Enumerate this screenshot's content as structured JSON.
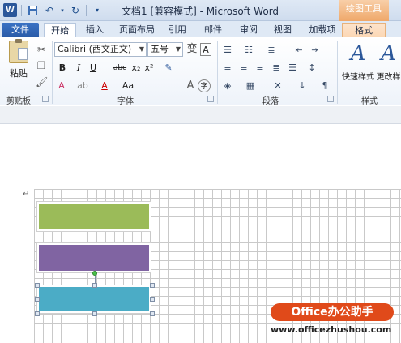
{
  "titlebar": {
    "app_icon": "W",
    "title": "文档1 [兼容模式] - Microsoft Word",
    "context_tool": "绘图工具"
  },
  "tabs": [
    {
      "label": "文件"
    },
    {
      "label": "开始"
    },
    {
      "label": "插入"
    },
    {
      "label": "页面布局"
    },
    {
      "label": "引用"
    },
    {
      "label": "邮件"
    },
    {
      "label": "审阅"
    },
    {
      "label": "视图"
    },
    {
      "label": "加载项"
    },
    {
      "label": "格式"
    }
  ],
  "clipboard": {
    "paste_label": "粘贴",
    "group_label": "剪贴板"
  },
  "font": {
    "font_name": "Calibri (西文正文)",
    "font_size": "五号",
    "group_label": "字体",
    "buttons": {
      "bold": "B",
      "italic": "I",
      "underline": "U",
      "strike": "abc",
      "subscript": "x₂",
      "superscript": "x²",
      "grow": "A",
      "shrink": "A",
      "font_color": "A",
      "change_case": "Aa"
    }
  },
  "paragraph": {
    "group_label": "段落"
  },
  "styles": {
    "quick_styles_label": "快速样式",
    "change_styles_label": "更改样",
    "group_label": "样式"
  },
  "document": {
    "paragraph_mark": "↵"
  },
  "watermark": {
    "badge": "Office办公助手",
    "url": "www.officezhushou.com"
  },
  "colors": {
    "green_shape": "#9bbb59",
    "purple_shape": "#8064a2",
    "blue_shape": "#4bacc6",
    "file_tab": "#2a5ca8",
    "watermark_badge": "#e04a1a"
  }
}
